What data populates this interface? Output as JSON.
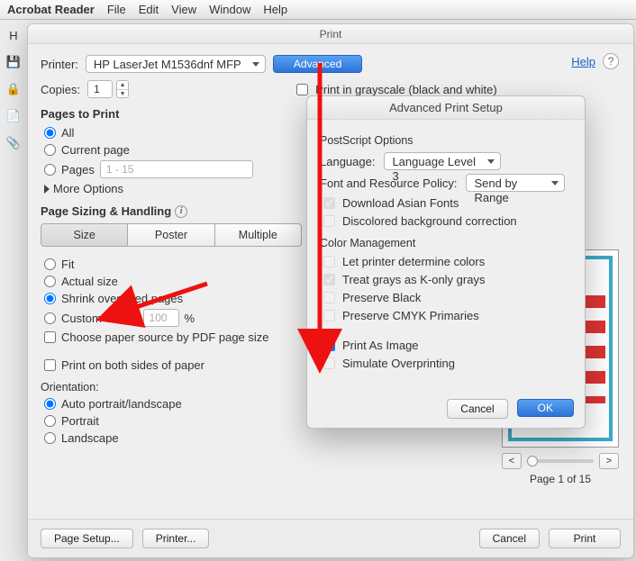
{
  "menubar": {
    "app": "Acrobat Reader",
    "items": [
      "File",
      "Edit",
      "View",
      "Window",
      "Help"
    ]
  },
  "dialog": {
    "title": "Print",
    "printer_label": "Printer:",
    "printer_value": "HP LaserJet M1536dnf MFP",
    "advanced_btn": "Advanced",
    "help_link": "Help",
    "copies_label": "Copies:",
    "copies_value": "1",
    "grayscale": "Print in grayscale (black and white)"
  },
  "pages": {
    "head": "Pages to Print",
    "all": "All",
    "current": "Current page",
    "pages_label": "Pages",
    "pages_range": "1 - 15",
    "more": "More Options"
  },
  "sizing": {
    "head": "Page Sizing & Handling",
    "tabs": [
      "Size",
      "Poster",
      "Multiple"
    ],
    "fit": "Fit",
    "actual": "Actual size",
    "shrink": "Shrink oversized pages",
    "custom": "Custom Scale:",
    "custom_val": "100",
    "pct": "%",
    "choose": "Choose paper source by PDF page size"
  },
  "both_sides": "Print on both sides of paper",
  "orientation": {
    "head": "Orientation:",
    "auto": "Auto portrait/landscape",
    "portrait": "Portrait",
    "landscape": "Landscape"
  },
  "bottom": {
    "page_setup": "Page Setup...",
    "printer": "Printer...",
    "cancel": "Cancel",
    "print": "Print"
  },
  "preview": {
    "page_of": "Page 1 of 15"
  },
  "adv": {
    "title": "Advanced Print Setup",
    "ps_head": "PostScript Options",
    "lang_label": "Language:",
    "lang_value": "Language Level 3",
    "font_label": "Font and Resource Policy:",
    "font_value": "Send by Range",
    "dl_asian": "Download Asian Fonts",
    "discolor": "Discolored background correction",
    "cm_head": "Color Management",
    "let_printer": "Let printer determine colors",
    "treat_gray": "Treat grays as K-only grays",
    "preserve_black": "Preserve Black",
    "preserve_cmyk": "Preserve CMYK Primaries",
    "print_image": "Print As Image",
    "simulate": "Simulate Overprinting",
    "cancel": "Cancel",
    "ok": "OK"
  }
}
